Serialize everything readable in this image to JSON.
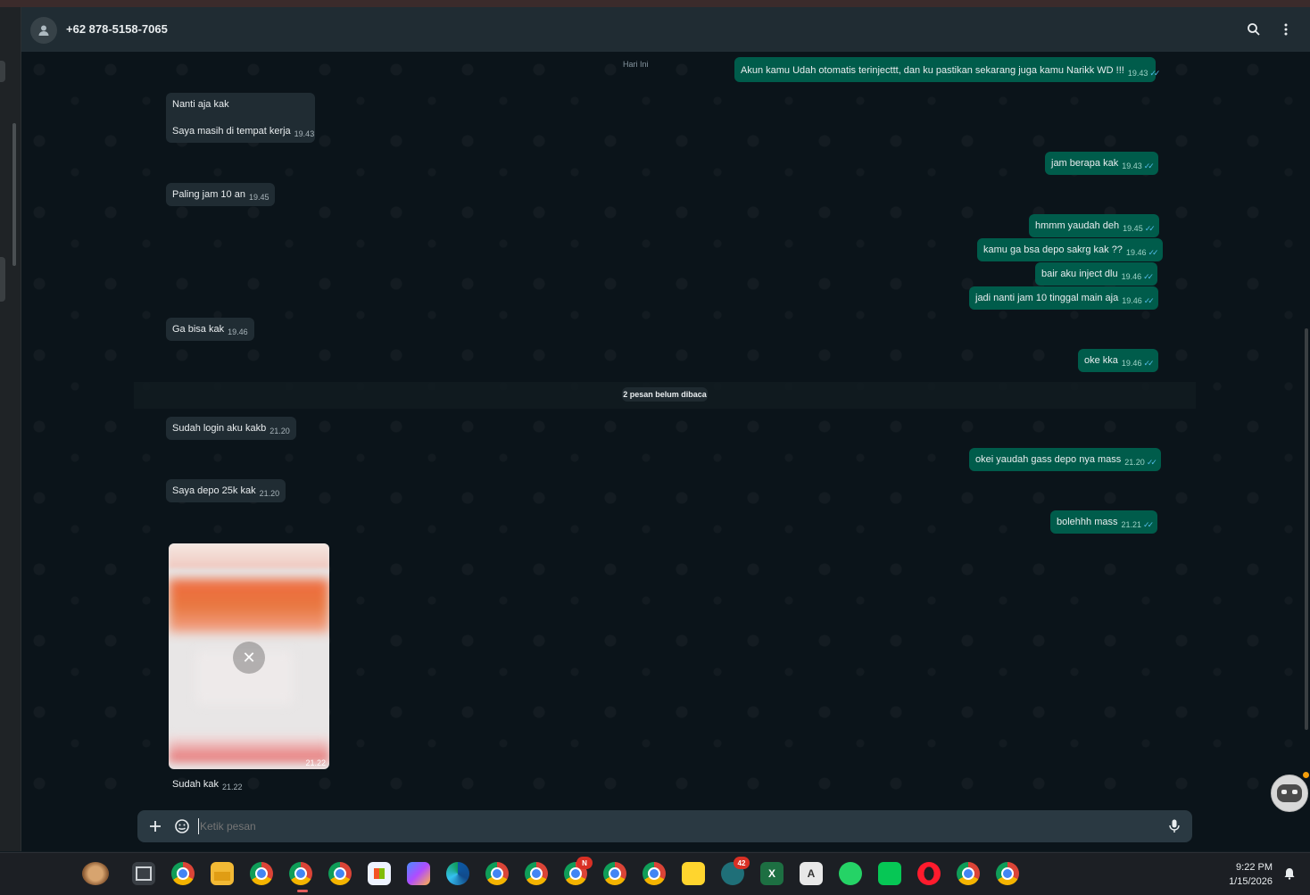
{
  "header": {
    "contact_name": "+62 878-5158-7065",
    "icons": [
      "person-icon",
      "search-icon",
      "more-vert-icon"
    ]
  },
  "chat": {
    "date_chip": "Hari Ini",
    "unread_label": "2 pesan belum dibaca",
    "messages": [
      {
        "dir": "out",
        "lines": [
          "Akun kamu Udah otomatis terinjecttt, dan ku pastikan sekarang juga kamu Narikk WD !!!"
        ],
        "time": "19.43"
      },
      {
        "dir": "in",
        "lines": [
          "Nanti aja kak",
          "Saya masih di tempat kerja"
        ],
        "time": "19.43"
      },
      {
        "dir": "out",
        "lines": [
          "jam berapa kak"
        ],
        "time": "19.43"
      },
      {
        "dir": "in",
        "lines": [
          "Paling jam 10 an"
        ],
        "time": "19.45"
      },
      {
        "dir": "out",
        "lines": [
          "hmmm yaudah deh"
        ],
        "time": "19.45"
      },
      {
        "dir": "out",
        "lines": [
          "kamu ga bsa depo sakrg kak ??"
        ],
        "time": "19.46"
      },
      {
        "dir": "out",
        "lines": [
          "bair aku inject dlu"
        ],
        "time": "19.46"
      },
      {
        "dir": "out",
        "lines": [
          "jadi nanti jam 10 tinggal main aja"
        ],
        "time": "19.46"
      },
      {
        "dir": "in",
        "lines": [
          "Ga bisa kak"
        ],
        "time": "19.46"
      },
      {
        "dir": "out",
        "lines": [
          "oke kka"
        ],
        "time": "19.46"
      },
      {
        "dir": "in",
        "lines": [
          "Sudah login aku kakb"
        ],
        "time": "21.20"
      },
      {
        "dir": "out",
        "lines": [
          "okei yaudah gass depo nya mass"
        ],
        "time": "21.20"
      },
      {
        "dir": "in",
        "lines": [
          "Saya depo 25k kak"
        ],
        "time": "21.20"
      },
      {
        "dir": "out",
        "lines": [
          "bolehhh mass"
        ],
        "time": "21.21"
      },
      {
        "dir": "in",
        "lines": [
          "Sudah kak"
        ],
        "time": "21.22"
      }
    ],
    "image_message": {
      "time": "21.22"
    }
  },
  "composer": {
    "placeholder": "Ketik pesan"
  },
  "taskbar": {
    "time": "9:22 PM",
    "date": "1/15/2026",
    "badges": {
      "n_badge": "N",
      "count_badge": "42"
    }
  }
}
